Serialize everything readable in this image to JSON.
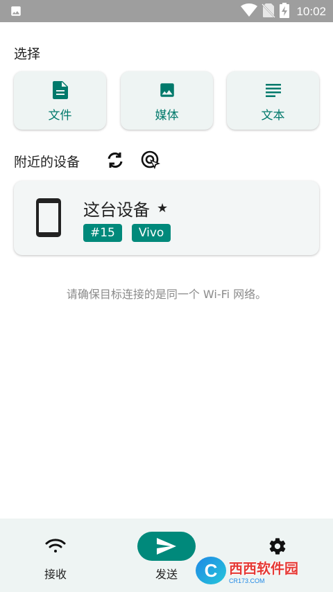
{
  "status_bar": {
    "time": "10:02",
    "icons": [
      "image-icon",
      "wifi-icon",
      "no-sim-icon",
      "battery-charging-icon"
    ]
  },
  "select_section": {
    "title": "选择",
    "cards": [
      {
        "label": "文件",
        "icon": "file-icon"
      },
      {
        "label": "媒体",
        "icon": "image-icon"
      },
      {
        "label": "文本",
        "icon": "text-icon"
      }
    ]
  },
  "nearby_section": {
    "title": "附近的设备",
    "icons": [
      "refresh-icon",
      "target-icon"
    ]
  },
  "device": {
    "name": "这台设备",
    "favorite_mark": "★",
    "tags": [
      "#15",
      "Vivo"
    ],
    "icon": "phone-icon"
  },
  "hint": "请确保目标连接的是同一个 Wi-Fi 网络。",
  "bottom_nav": {
    "items": [
      {
        "label": "接收",
        "icon": "wifi-icon"
      },
      {
        "label": "发送",
        "icon": "send-icon"
      },
      {
        "label": "",
        "icon": "gear-icon"
      }
    ]
  },
  "watermark": {
    "logo": "C",
    "text": "西西软件园",
    "sub": "CR173.COM"
  },
  "colors": {
    "accent": "#00897b",
    "accent_text": "#00796b",
    "card_bg": "#eef4f3",
    "status_bar": "#9e9e9e"
  }
}
